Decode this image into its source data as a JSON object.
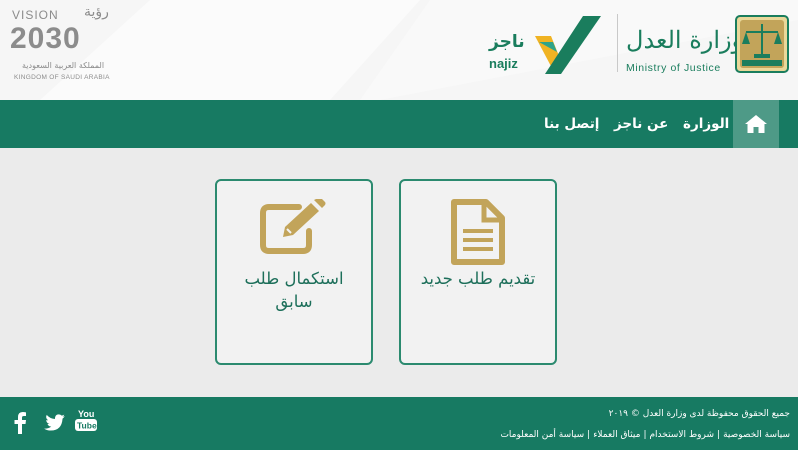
{
  "header": {
    "vision_logo": {
      "en_title": "VISION",
      "ar_title": "رؤية",
      "year": "2030",
      "ar_subtitle": "المملكة العربية السعودية",
      "en_subtitle": "KINGDOM OF SAUDI ARABIA"
    },
    "najiz_logo": {
      "ar_name": "ناجز",
      "en_name": "najiz"
    },
    "moj_logo": {
      "ar_name": "وزارة العدل",
      "en_name": "Ministry of Justice"
    }
  },
  "nav": {
    "home_icon": "home-icon",
    "items": [
      {
        "label": "الوزارة"
      },
      {
        "label": "عن ناجز"
      },
      {
        "label": "إتصل بنا"
      }
    ]
  },
  "cards": [
    {
      "label": "تقديم طلب جديد",
      "icon": "document-icon"
    },
    {
      "label": "استكمال طلب سابق",
      "icon": "edit-icon"
    }
  ],
  "footer": {
    "copyright": "جميع الحقوق محفوظة لدى وزارة العدل © ٢٠١٩",
    "links": [
      {
        "label": "سياسة الخصوصية"
      },
      {
        "label": "شروط الاستخدام"
      },
      {
        "label": "ميثاق العملاء"
      },
      {
        "label": "سياسة أمن المعلومات"
      }
    ],
    "social": [
      "facebook-icon",
      "twitter-icon",
      "youtube-icon"
    ]
  },
  "colors": {
    "primary_green": "#177a62",
    "gold": "#c2a45a",
    "card_border": "#2b8a6f"
  }
}
